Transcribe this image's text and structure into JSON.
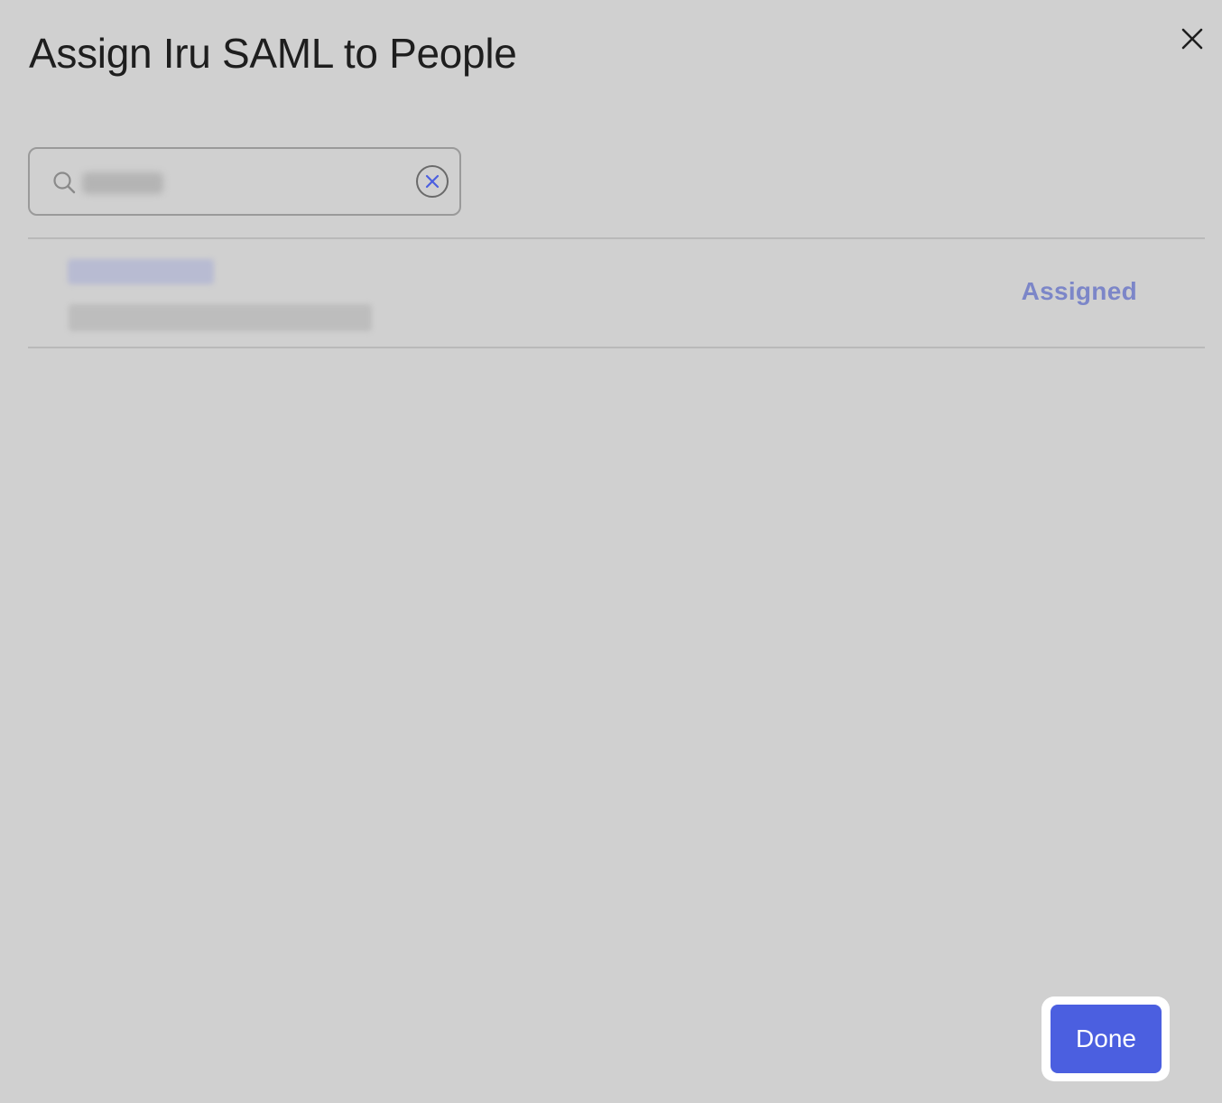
{
  "modal": {
    "title": "Assign Iru SAML to People",
    "close_icon": "close-icon"
  },
  "search": {
    "icon": "search-icon",
    "value": "",
    "clear_icon": "clear-circle-icon"
  },
  "results": [
    {
      "name": "",
      "email": "",
      "status": "Assigned"
    }
  ],
  "footer": {
    "done_label": "Done"
  },
  "colors": {
    "background": "#d0d0d0",
    "accent": "#4b5fe0",
    "status_text": "#7c86c8",
    "title_text": "#1e1e1e"
  }
}
